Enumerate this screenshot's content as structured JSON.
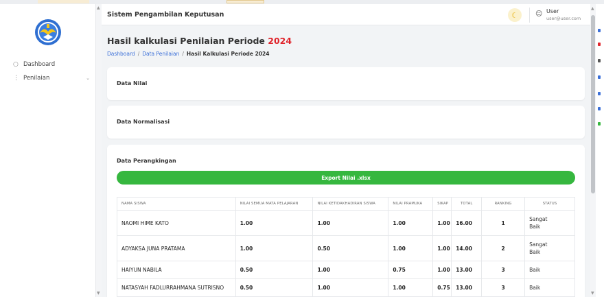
{
  "app": {
    "title": "Sistem Pengambilan Keputusan",
    "logo_icon": "tut-wuri-handayani-logo"
  },
  "user": {
    "name": "User",
    "email": "user@user.com"
  },
  "sidebar": {
    "items": [
      {
        "label": "Dashboard",
        "icon": "circle-icon"
      },
      {
        "label": "Penilaian",
        "icon": "list-icon",
        "has_submenu": true
      }
    ]
  },
  "page": {
    "title": "Hasil kalkulasi Penilaian Periode",
    "year": "2024",
    "breadcrumb": [
      "Dashboard",
      "Data Penilaian",
      "Hasil Kalkulasi Periode 2024"
    ]
  },
  "cards": {
    "data_nilai": "Data Nilai",
    "data_normalisasi": "Data Normalisasi",
    "data_perangkingan": "Data Perangkingan"
  },
  "export_button": "Export Nilai .xlsx",
  "table": {
    "headers": [
      "NAMA SISWA",
      "NILAI SEMUA MATA PELAJARAN",
      "NILAI KETIDAKHADIRAN SISWA",
      "NILAI PRAMUKA",
      "SIKAP",
      "TOTAL",
      "RANKING",
      "STATUS"
    ],
    "rows": [
      {
        "nama": "NAOMI HIME KATO",
        "mapel": "1.00",
        "hadir": "1.00",
        "pramuka": "1.00",
        "sikap": "1.00",
        "total": "16.00",
        "ranking": "1",
        "status1": "Sangat",
        "status2": "Baik"
      },
      {
        "nama": "ADYAKSA JUNA PRATAMA",
        "mapel": "1.00",
        "hadir": "0.50",
        "pramuka": "1.00",
        "sikap": "1.00",
        "total": "14.00",
        "ranking": "2",
        "status1": "Sangat",
        "status2": "Baik"
      },
      {
        "nama": "HAIYUN NABILA",
        "mapel": "0.50",
        "hadir": "1.00",
        "pramuka": "0.75",
        "sikap": "1.00",
        "total": "13.00",
        "ranking": "3",
        "status1": "Baik",
        "status2": ""
      },
      {
        "nama": "NATASYAH FADLURRAHMANA SUTRISNO",
        "mapel": "0.50",
        "hadir": "1.00",
        "pramuka": "1.00",
        "sikap": "0.75",
        "total": "13.00",
        "ranking": "3",
        "status1": "Baik",
        "status2": ""
      }
    ]
  },
  "colors": {
    "accent_green": "#36b73f",
    "year_red": "#e0242b",
    "link_blue": "#3b6fd8"
  }
}
